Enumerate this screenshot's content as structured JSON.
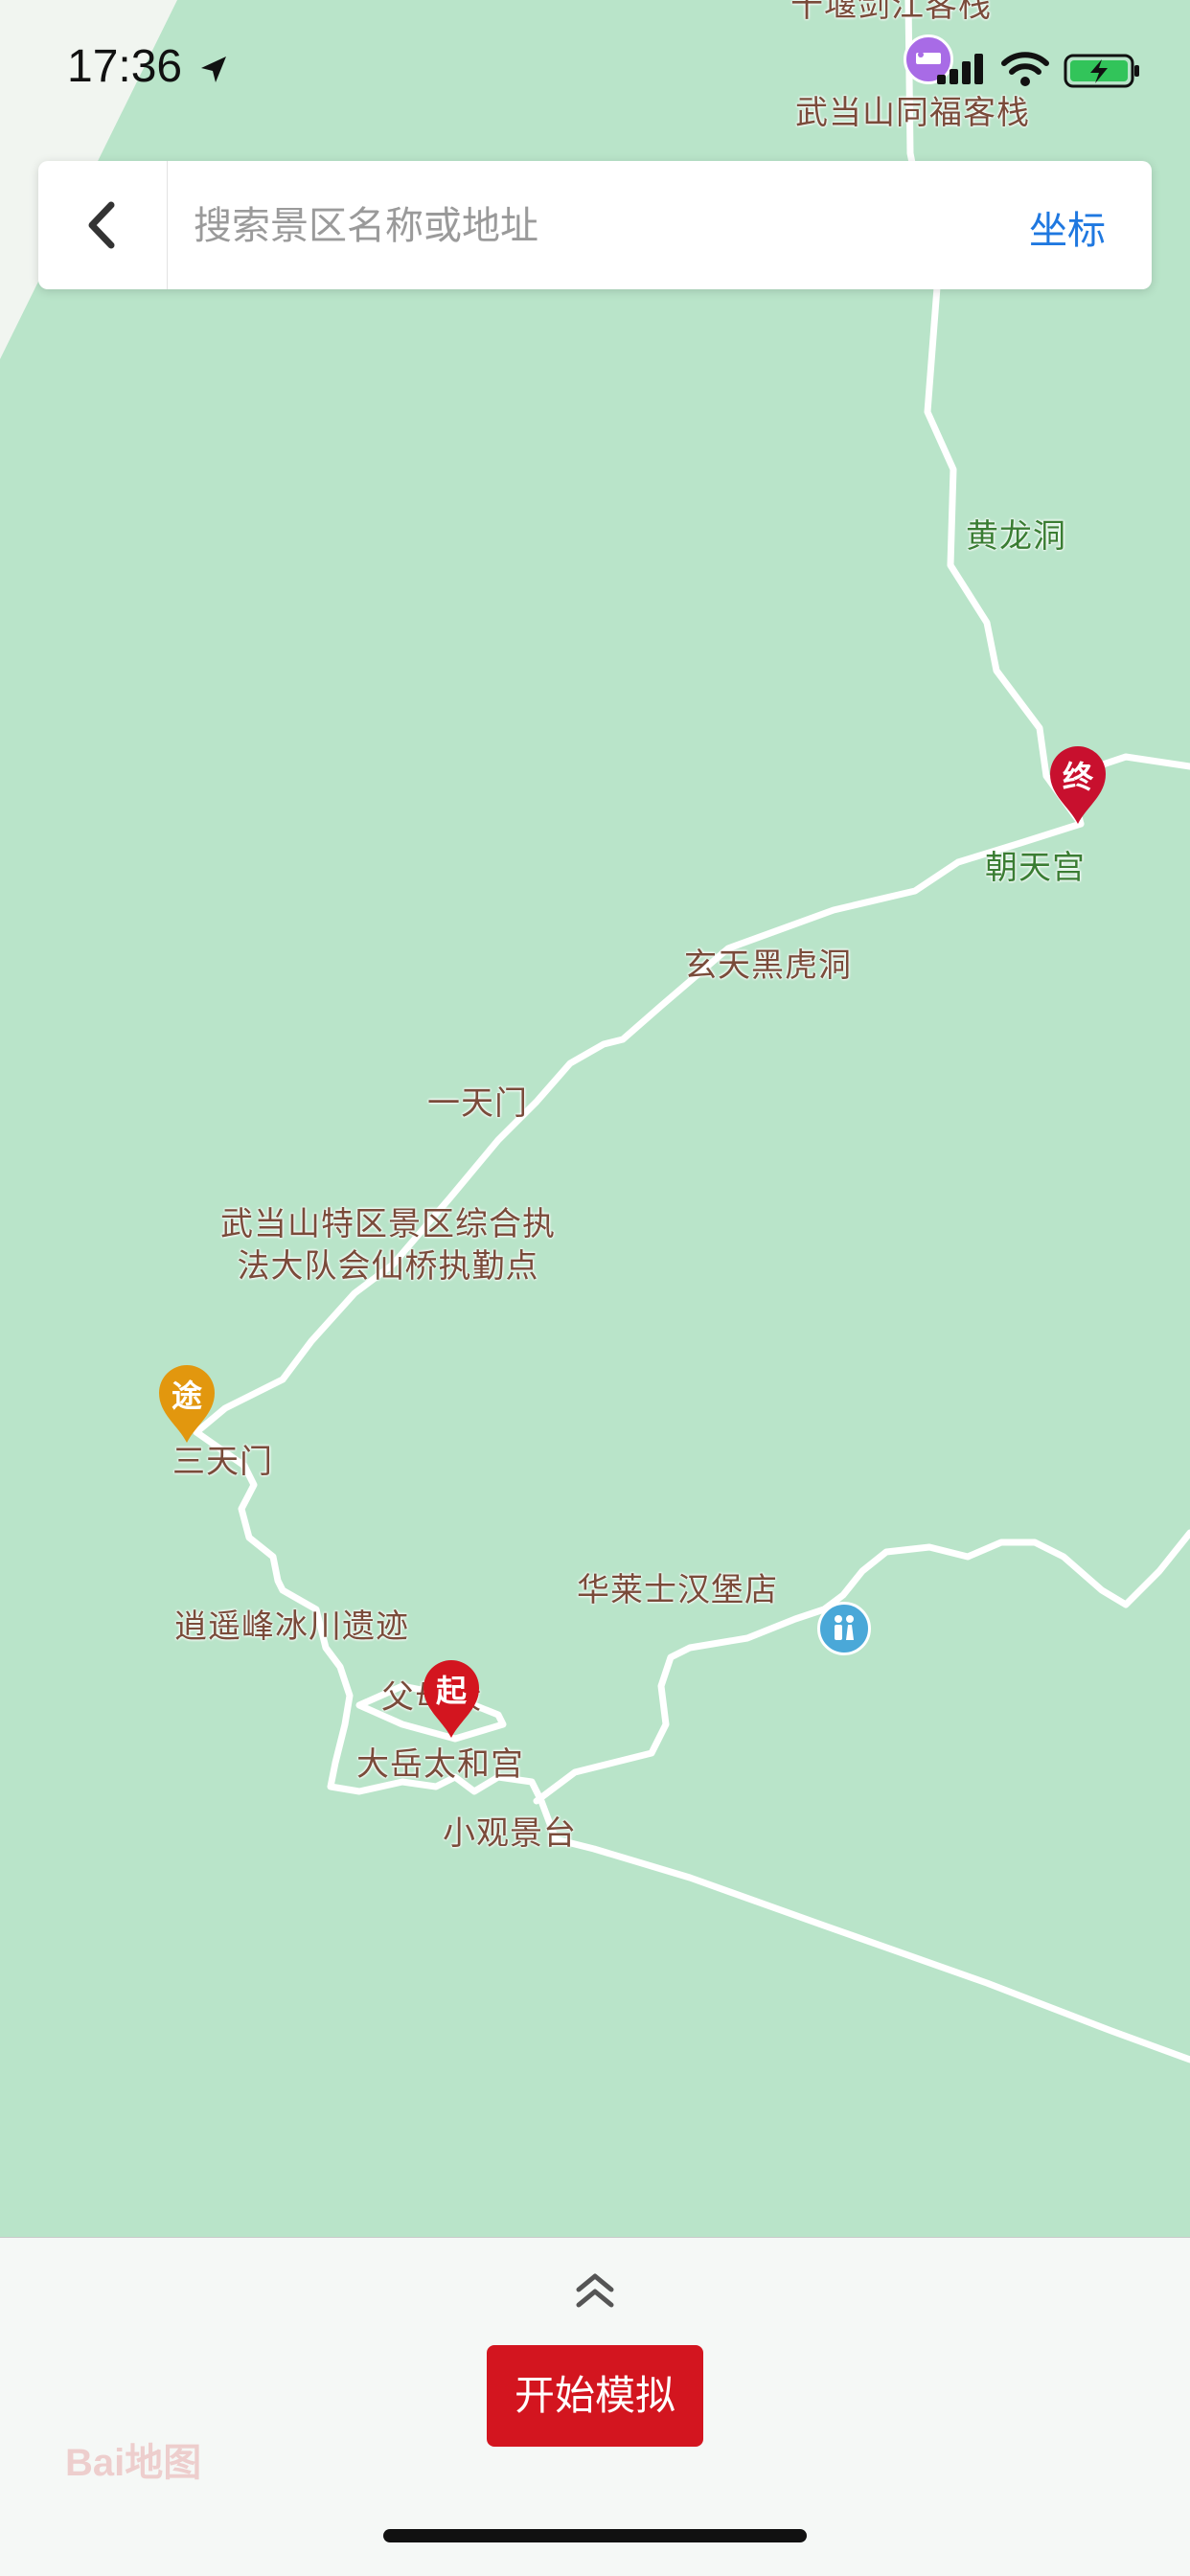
{
  "status_bar": {
    "time": "17:36"
  },
  "search": {
    "placeholder": "搜索景区名称或地址",
    "coordinate_label": "坐标"
  },
  "map": {
    "labels": {
      "top_cut": "十堰剑江客栈",
      "tongfu_inn": "武当山同福客栈",
      "huanglong_cave": "黄龙洞",
      "chaotian_palace": "朝天宫",
      "xuantian_cave": "玄天黑虎洞",
      "yitianmen": "一天门",
      "enforcement_point": "武当山特区景区综合执\n法大队会仙桥执勤点",
      "santianmen": "三天门",
      "xiaoyaofeng": "逍遥峰冰川遗迹",
      "wallace": "华莱士汉堡店",
      "fumu": "父母殿",
      "taihe_palace": "大岳太和宫",
      "xiaoguan": "小观景台"
    },
    "markers": {
      "start": "起",
      "end": "终",
      "waypoint": "途"
    },
    "icons": {
      "hotel": "hotel-icon",
      "restroom": "restroom-icon"
    }
  },
  "bottom": {
    "start_button": "开始模拟",
    "map_logo": "Bai地图"
  },
  "colors": {
    "map_green": "#b9e4c9",
    "accent_blue": "#1f78e0",
    "start_red": "#d3151f",
    "waypoint_orange": "#e2970e"
  }
}
